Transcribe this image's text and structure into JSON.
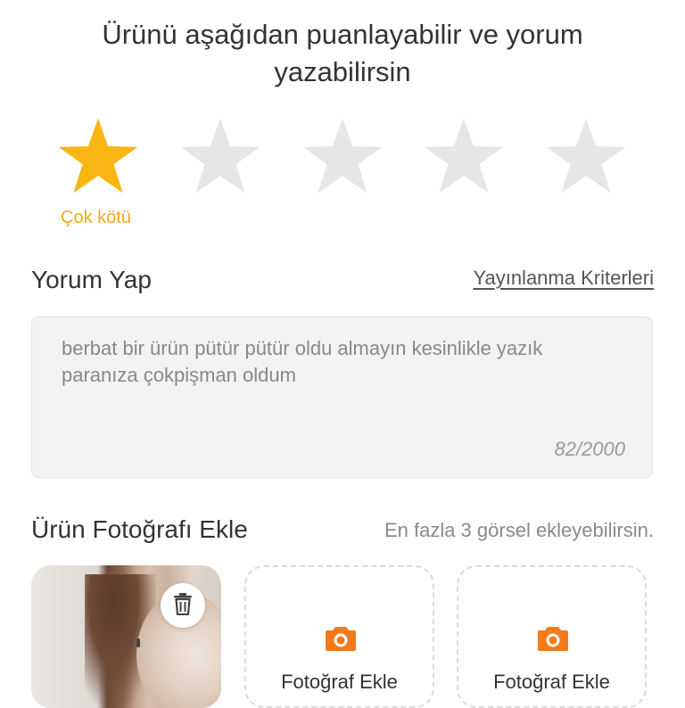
{
  "header": {
    "title": "Ürünü aşağıdan puanlayabilir ve yorum yazabilirsin"
  },
  "rating": {
    "value": 1,
    "max": 5,
    "selected_label": "Çok kötü",
    "colors": {
      "active": "#f7b614",
      "inactive": "#e6e6e6",
      "label": "#f6a716"
    }
  },
  "review": {
    "section_title": "Yorum Yap",
    "criteria_link": "Yayınlanma Kriterleri",
    "comment_text": "berbat bir ürün pütür pütür oldu almayın kesinlikle yazık paranıza çokpişman oldum",
    "char_count": "82/2000"
  },
  "photos": {
    "section_title": "Ürün Fotoğrafı Ekle",
    "hint": "En fazla 3 görsel ekleyebilirsin.",
    "uploaded_icon": "trash-icon",
    "add_label": "Fotoğraf Ekle",
    "add_icon": "camera-icon",
    "accent": "#f27a1a"
  }
}
